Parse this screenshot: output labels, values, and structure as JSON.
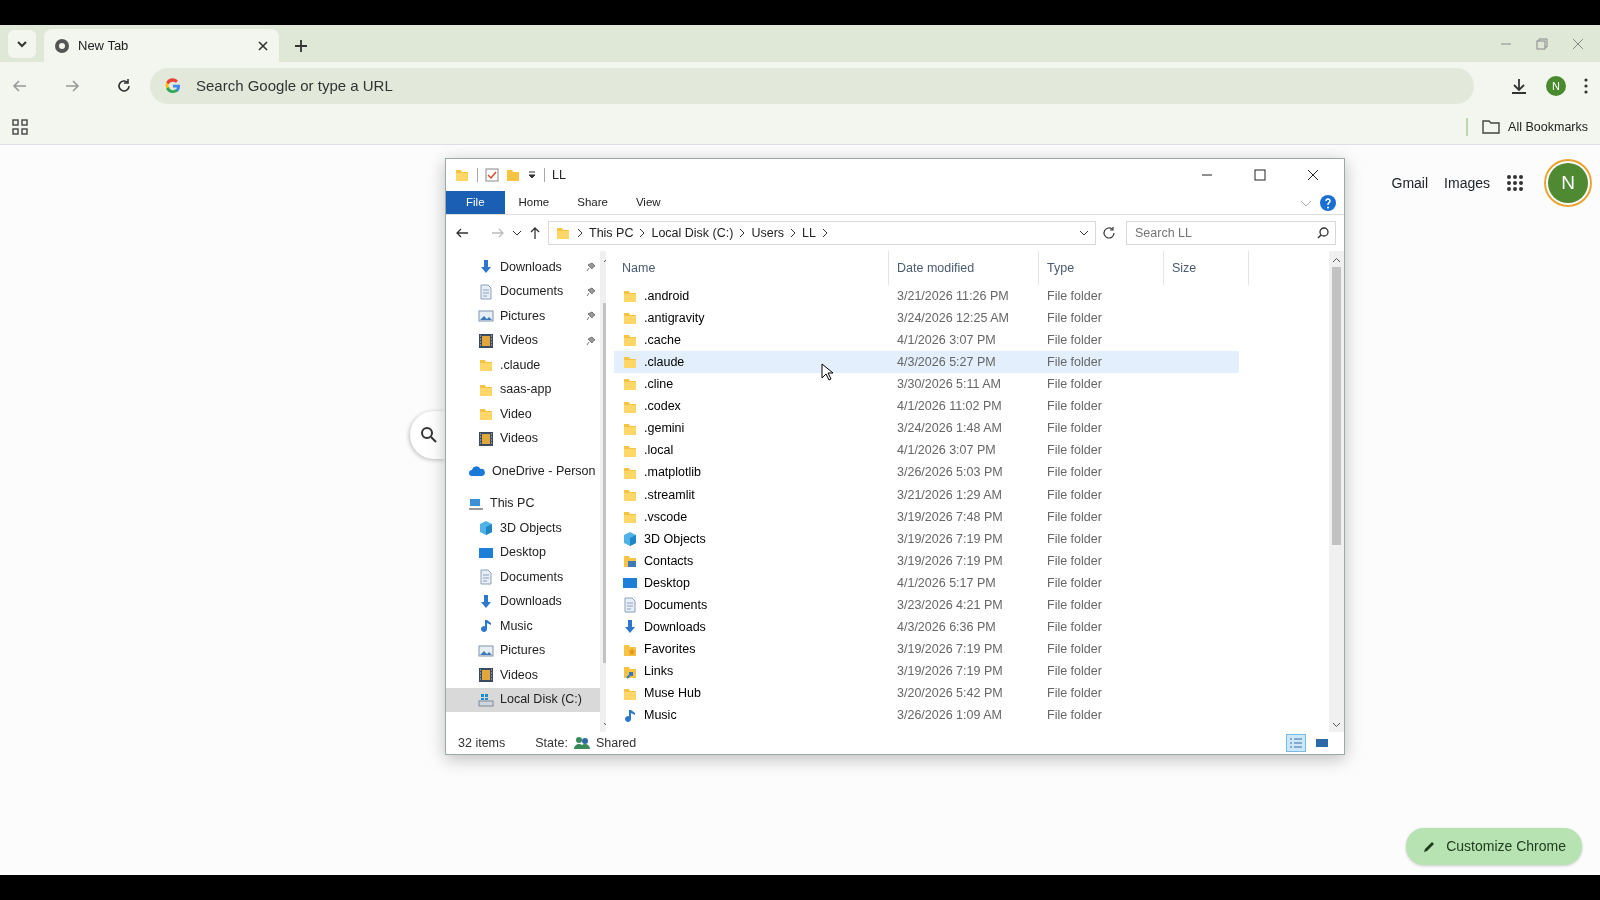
{
  "browser": {
    "tabs": [
      {
        "title": "New Tab",
        "selected": true
      }
    ],
    "address": {
      "placeholder": "Search Google or type a URL"
    },
    "profile": "N",
    "bookmarks": {
      "label": "All Bookmarks"
    }
  },
  "page": {
    "links": [
      "Gmail",
      "Images"
    ],
    "avatar": "N",
    "customize_button": "Customize Chrome"
  },
  "explorer": {
    "title": "LL",
    "ribbon_tabs": [
      {
        "label": "File",
        "selected": true
      },
      {
        "label": "Home",
        "selected": false
      },
      {
        "label": "Share",
        "selected": false
      },
      {
        "label": "View",
        "selected": false
      }
    ],
    "breadcrumb": [
      "This PC",
      "Local Disk (C:)",
      "Users",
      "LL"
    ],
    "search": {
      "placeholder": "Search LL"
    },
    "nav": {
      "quick_access": [
        {
          "label": "Downloads",
          "kind": "download",
          "pinned": true,
          "selected": false
        },
        {
          "label": "Documents",
          "kind": "document",
          "pinned": true,
          "selected": false
        },
        {
          "label": "Pictures",
          "kind": "pictures",
          "pinned": true,
          "selected": false
        },
        {
          "label": "Videos",
          "kind": "videos",
          "pinned": true,
          "selected": false
        },
        {
          "label": ".claude",
          "kind": "folder",
          "pinned": false,
          "selected": false
        },
        {
          "label": "saas-app",
          "kind": "folder",
          "pinned": false,
          "selected": false
        },
        {
          "label": "Video",
          "kind": "folder",
          "pinned": false,
          "selected": false
        },
        {
          "label": "Videos",
          "kind": "videos",
          "pinned": false,
          "selected": false
        }
      ],
      "onedrive": {
        "label": "OneDrive - Person",
        "selected": false
      },
      "this_pc": {
        "label": "This PC",
        "selected": false,
        "children": [
          {
            "label": "3D Objects",
            "kind": "cube",
            "selected": false
          },
          {
            "label": "Desktop",
            "kind": "desktop",
            "selected": false
          },
          {
            "label": "Documents",
            "kind": "document",
            "selected": false
          },
          {
            "label": "Downloads",
            "kind": "download",
            "selected": false
          },
          {
            "label": "Music",
            "kind": "music",
            "selected": false
          },
          {
            "label": "Pictures",
            "kind": "pictures",
            "selected": false
          },
          {
            "label": "Videos",
            "kind": "videos",
            "selected": false
          },
          {
            "label": "Local Disk (C:)",
            "kind": "drive",
            "selected": true
          }
        ]
      }
    },
    "columns": [
      "Name",
      "Date modified",
      "Type",
      "Size"
    ],
    "rows": [
      {
        "name": ".android",
        "date": "3/21/2026 11:26 PM",
        "type": "File folder",
        "kind": "folder",
        "selected": false
      },
      {
        "name": ".antigravity",
        "date": "3/24/2026 12:25 AM",
        "type": "File folder",
        "kind": "folder",
        "selected": false
      },
      {
        "name": ".cache",
        "date": "4/1/2026 3:07 PM",
        "type": "File folder",
        "kind": "folder",
        "selected": false
      },
      {
        "name": ".claude",
        "date": "4/3/2026 5:27 PM",
        "type": "File folder",
        "kind": "folder",
        "selected": true
      },
      {
        "name": ".cline",
        "date": "3/30/2026 5:11 AM",
        "type": "File folder",
        "kind": "folder",
        "selected": false
      },
      {
        "name": ".codex",
        "date": "4/1/2026 11:02 PM",
        "type": "File folder",
        "kind": "folder",
        "selected": false
      },
      {
        "name": ".gemini",
        "date": "3/24/2026 1:48 AM",
        "type": "File folder",
        "kind": "folder",
        "selected": false
      },
      {
        "name": ".local",
        "date": "4/1/2026 3:07 PM",
        "type": "File folder",
        "kind": "folder",
        "selected": false
      },
      {
        "name": ".matplotlib",
        "date": "3/26/2026 5:03 PM",
        "type": "File folder",
        "kind": "folder",
        "selected": false
      },
      {
        "name": ".streamlit",
        "date": "3/21/2026 1:29 AM",
        "type": "File folder",
        "kind": "folder",
        "selected": false
      },
      {
        "name": ".vscode",
        "date": "3/19/2026 7:48 PM",
        "type": "File folder",
        "kind": "folder",
        "selected": false
      },
      {
        "name": "3D Objects",
        "date": "3/19/2026 7:19 PM",
        "type": "File folder",
        "kind": "cube",
        "selected": false
      },
      {
        "name": "Contacts",
        "date": "3/19/2026 7:19 PM",
        "type": "File folder",
        "kind": "contacts",
        "selected": false
      },
      {
        "name": "Desktop",
        "date": "4/1/2026 5:17 PM",
        "type": "File folder",
        "kind": "desktop",
        "selected": false
      },
      {
        "name": "Documents",
        "date": "3/23/2026 4:21 PM",
        "type": "File folder",
        "kind": "document",
        "selected": false
      },
      {
        "name": "Downloads",
        "date": "4/3/2026 6:36 PM",
        "type": "File folder",
        "kind": "download",
        "selected": false
      },
      {
        "name": "Favorites",
        "date": "3/19/2026 7:19 PM",
        "type": "File folder",
        "kind": "favorites",
        "selected": false
      },
      {
        "name": "Links",
        "date": "3/19/2026 7:19 PM",
        "type": "File folder",
        "kind": "links",
        "selected": false
      },
      {
        "name": "Muse Hub",
        "date": "3/20/2026 5:42 PM",
        "type": "File folder",
        "kind": "folder",
        "selected": false
      },
      {
        "name": "Music",
        "date": "3/26/2026 1:09 AM",
        "type": "File folder",
        "kind": "music",
        "selected": false
      }
    ],
    "status": {
      "count": "32 items",
      "state_label": "State:",
      "state_value": "Shared"
    }
  }
}
